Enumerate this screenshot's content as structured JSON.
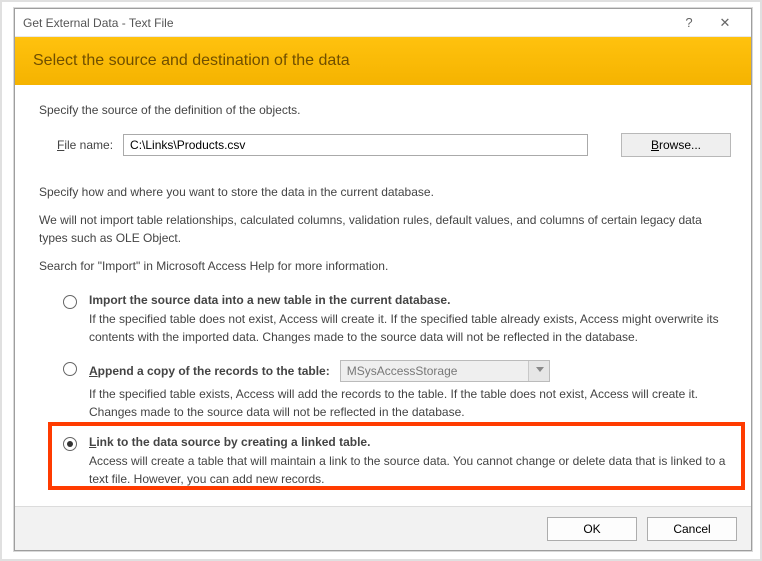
{
  "titlebar": {
    "title": "Get External Data - Text File",
    "help": "?",
    "close": "✕"
  },
  "banner": {
    "heading": "Select the source and destination of the data"
  },
  "source": {
    "label_pre": "Specify the source of the definition of the objects.",
    "file_label_pre": "F",
    "file_label_rest": "ile name:",
    "file_value": "C:\\Links\\Products.csv",
    "browse_pre": "B",
    "browse_rest": "rowse..."
  },
  "store": {
    "line1": "Specify how and where you want to store the data in the current database.",
    "line2": "We will not import table relationships, calculated columns, validation rules, default values, and columns of certain legacy data types such as OLE Object.",
    "line3": "Search for \"Import\" in Microsoft Access Help for more information."
  },
  "options": {
    "import": {
      "title": "Import the source data into a new table in the current database.",
      "desc": "If the specified table does not exist, Access will create it. If the specified table already exists, Access might overwrite its contents with the imported data. Changes made to the source data will not be reflected in the database."
    },
    "append": {
      "title_pre": "A",
      "title_rest": "ppend a copy of the records to the table:",
      "select_value": "MSysAccessStorage",
      "desc": "If the specified table exists, Access will add the records to the table. If the table does not exist, Access will create it. Changes made to the source data will not be reflected in the database."
    },
    "link": {
      "title_pre": "L",
      "title_rest": "ink to the data source by creating a linked table.",
      "desc": "Access will create a table that will maintain a link to the source data. You cannot change or delete data that is linked to a text file. However, you can add new records."
    }
  },
  "footer": {
    "ok": "OK",
    "cancel": "Cancel"
  }
}
